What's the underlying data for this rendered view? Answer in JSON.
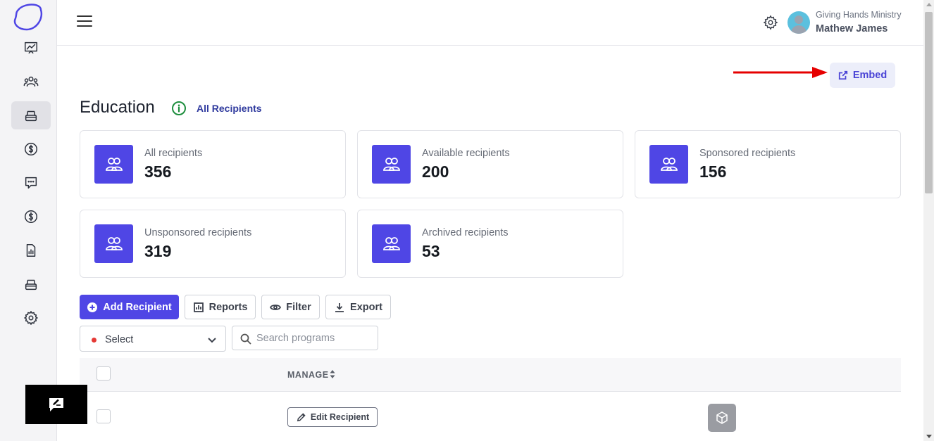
{
  "header": {
    "org_name": "Giving Hands Ministry",
    "user_name": "Mathew James"
  },
  "sidebar": {
    "items": [
      {
        "icon": "analytics-icon"
      },
      {
        "icon": "users-icon"
      },
      {
        "icon": "education-icon",
        "active": true
      },
      {
        "icon": "dollar-icon"
      },
      {
        "icon": "chat-icon"
      },
      {
        "icon": "dollar-icon"
      },
      {
        "icon": "report-icon"
      },
      {
        "icon": "inventory-icon"
      },
      {
        "icon": "gear-icon"
      }
    ]
  },
  "embed": {
    "label": "Embed"
  },
  "page": {
    "title": "Education",
    "all_link": "All Recipients"
  },
  "stats": [
    {
      "label": "All recipients",
      "value": "356"
    },
    {
      "label": "Available recipients",
      "value": "200"
    },
    {
      "label": "Sponsored recipients",
      "value": "156"
    },
    {
      "label": "Unsponsored recipients",
      "value": "319"
    },
    {
      "label": "Archived recipients",
      "value": "53"
    }
  ],
  "toolbar": {
    "add_label": "Add Recipient",
    "reports_label": "Reports",
    "filter_label": "Filter",
    "export_label": "Export"
  },
  "filters": {
    "select_value": "Select",
    "search_placeholder": "Search programs"
  },
  "table": {
    "header_manage": "MANAGE",
    "rows": [
      {
        "edit_label": "Edit Recipient"
      }
    ]
  },
  "colors": {
    "accent": "#4f46e5",
    "arrow": "#e60000"
  }
}
